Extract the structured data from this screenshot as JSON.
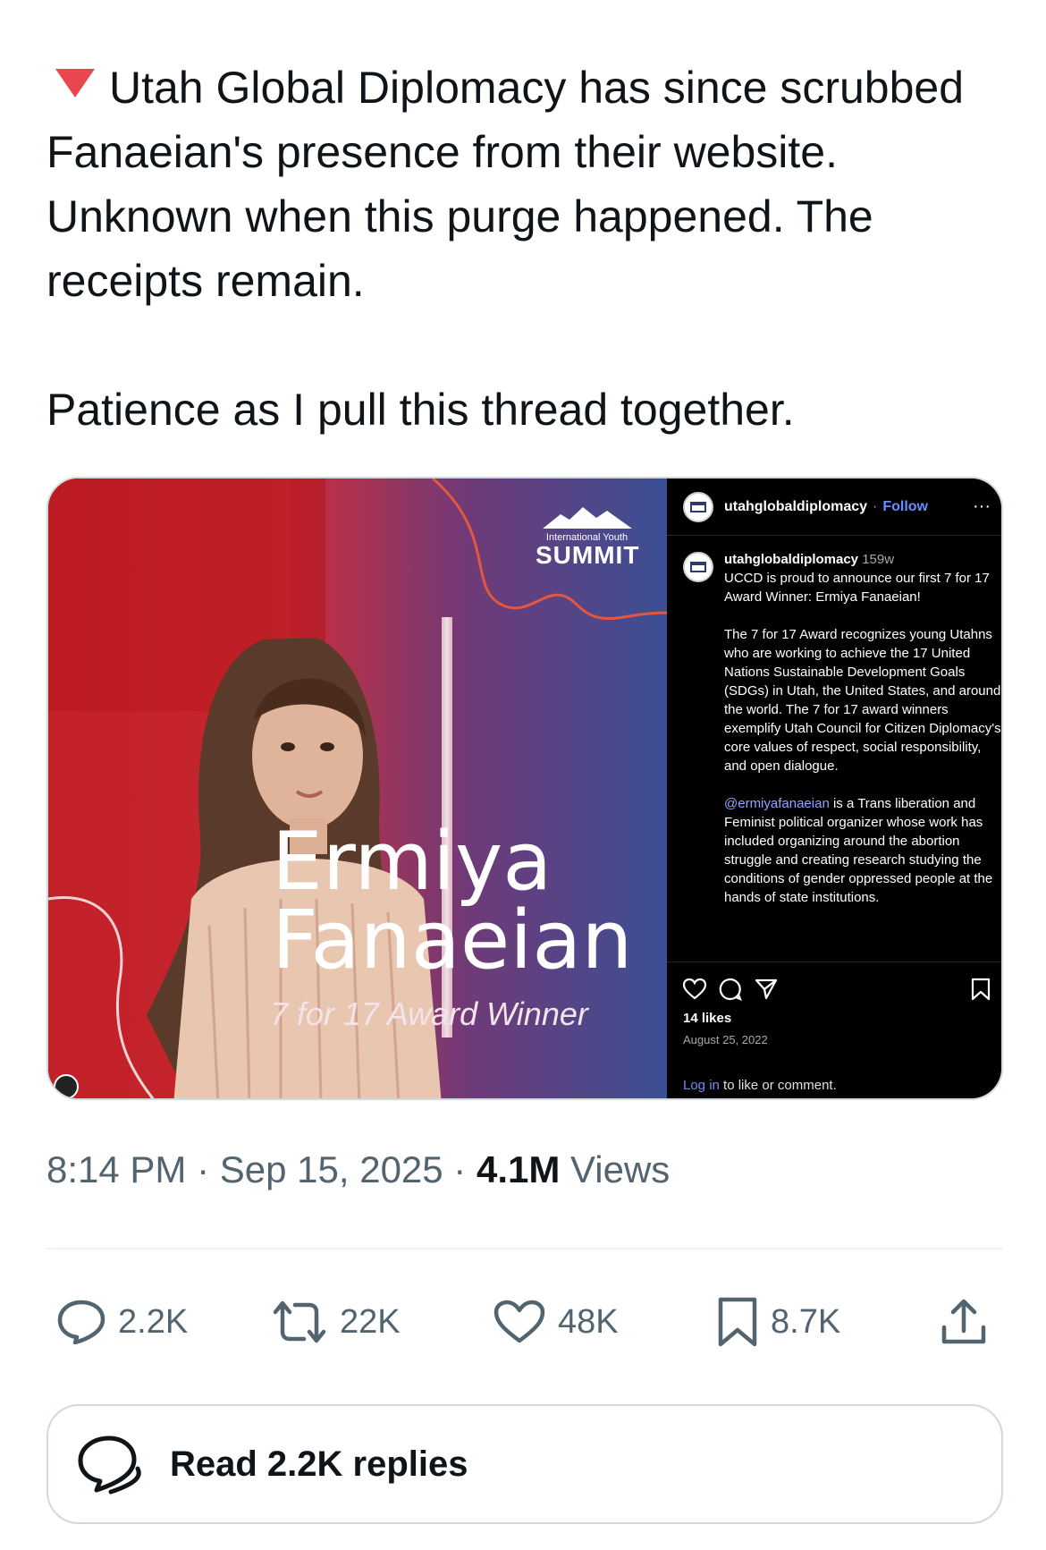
{
  "tweet": {
    "line1": "Utah Global Diplomacy has since scrubbed Fanaeian's presence from their website. Unknown when this purge happened. The receipts remain.",
    "line2": "Patience as I pull this thread together."
  },
  "media": {
    "poster": {
      "summit_small": "International Youth",
      "summit_big": "SUMMIT",
      "name_first": "Ermiya",
      "name_last": "Fanaeian",
      "award": "7 for 17 Award Winner"
    },
    "instagram": {
      "username": "utahglobaldiplomacy",
      "follow": "Follow",
      "post_age": "159w",
      "caption_p1": "UCCD is proud to announce our first 7 for 17 Award Winner: Ermiya Fanaeian!",
      "caption_p2": "The 7 for 17 Award recognizes young Utahns who are working to achieve the 17 United Nations Sustainable Development Goals (SDGs) in Utah, the United States, and around the world. The 7 for 17 award winners exemplify Utah Council for Citizen Diplomacy's core values of respect, social responsibility, and open dialogue.",
      "mention": "@ermiyafanaeian",
      "caption_p3": " is a Trans liberation and Feminist political organizer whose work has included organizing around the abortion struggle and creating research studying the conditions of gender oppressed people at the hands of state institutions.",
      "likes": "14 likes",
      "date": "August 25, 2022",
      "login_link": "Log in",
      "login_rest": " to like or comment."
    }
  },
  "meta": {
    "time": "8:14 PM",
    "date": "Sep 15, 2025",
    "views_count": "4.1M",
    "views_label": "Views"
  },
  "actions": {
    "replies": "2.2K",
    "reposts": "22K",
    "likes": "48K",
    "bookmarks": "8.7K"
  },
  "read_replies": "Read 2.2K replies",
  "colors": {
    "accent_triangle": "#e8474f",
    "secondary_text": "#536471",
    "border": "#cfd9de"
  }
}
